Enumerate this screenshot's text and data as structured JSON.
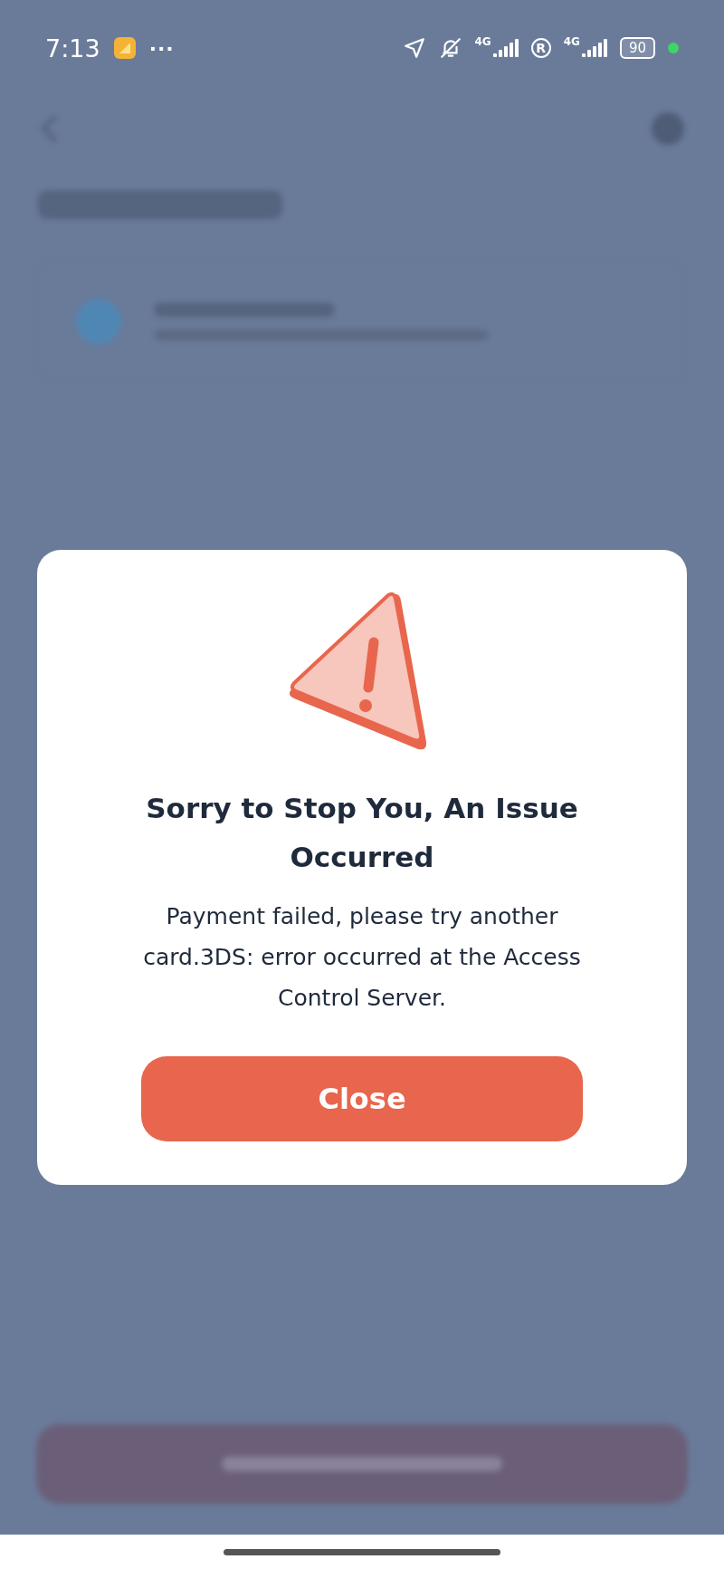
{
  "status_bar": {
    "time": "7:13",
    "more": "···",
    "network_1": "4G",
    "roaming": "R",
    "network_2": "4G",
    "battery": "90"
  },
  "dialog": {
    "title": "Sorry to Stop You, An Issue Occurred",
    "message": "Payment failed, please try another card.3DS: error occurred at the Access Control Server.",
    "button": "Close"
  }
}
